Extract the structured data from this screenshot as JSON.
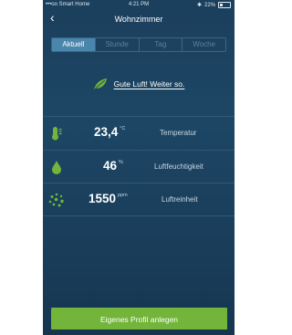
{
  "status_bar": {
    "carrier": "•••oo Smart Home",
    "time": "4:21 PM",
    "bluetooth": "✱",
    "battery": "22%"
  },
  "nav": {
    "back_glyph": "‹",
    "title": "Wohnzimmer"
  },
  "tabs": [
    {
      "label": "Aktuell",
      "active": true
    },
    {
      "label": "Stunde",
      "active": false
    },
    {
      "label": "Tag",
      "active": false
    },
    {
      "label": "Woche",
      "active": false
    }
  ],
  "feedback": {
    "icon": "leaf-icon",
    "text": "Gute Luft! Weiter so."
  },
  "measurements": [
    {
      "icon": "thermometer-icon",
      "value": "23,4",
      "unit": "°C",
      "label": "Temperatur"
    },
    {
      "icon": "water-drop-icon",
      "value": "46",
      "unit": "%",
      "label": "Luftfeuchtigkeit"
    },
    {
      "icon": "dots-icon",
      "value": "1550",
      "unit": "ppm",
      "label": "Luftreinheit"
    }
  ],
  "cta": {
    "label": "Eigenes Profil anlegen"
  },
  "colors": {
    "accent_green": "#72b53a",
    "background": "#1d4665",
    "tab_active": "#4a86ac"
  }
}
